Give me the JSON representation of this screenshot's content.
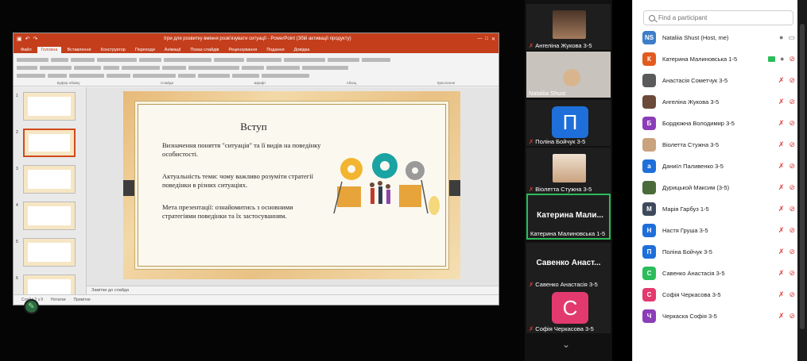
{
  "powerpoint": {
    "window_title": "Ігри для розвитку вміння розв'язувати ситуації - PowerPoint (Збій активації продукту)",
    "tabs": [
      "Файл",
      "Головна",
      "Вставлення",
      "Конструктор",
      "Переходи",
      "Анімації",
      "Показ слайдів",
      "Рецензування",
      "Подання",
      "Довідка"
    ],
    "active_tab": "Головна",
    "ribbon_groups": [
      "Буфер обміну",
      "Слайди",
      "Шрифт",
      "Абзац",
      "Креслення"
    ],
    "notes_placeholder": "Замітки до слайда",
    "status_items": [
      "Слайд 2 з 9",
      "Нотатки",
      "Примітки"
    ],
    "slide": {
      "title": "Вступ",
      "paragraphs": [
        "Визначення поняття \"ситуація\" та її видів на поведінку особистості.",
        "Актуальність теми: чому важливо розуміти стратегії поведінки в різних ситуаціях.",
        "Мета презентації: ознайомитись з основними стратегіями поведінки та їх застосуванням."
      ]
    },
    "thumb_numbers": [
      "1",
      "2",
      "3",
      "4",
      "5",
      "6"
    ]
  },
  "video_tiles": [
    {
      "name": "Ангеліна Жукова 3-5",
      "muted": true
    },
    {
      "name": "Nataliia Shust",
      "muted": false
    },
    {
      "name": "Поліна Бойчук 3-5",
      "muted": true,
      "initial": "П",
      "color": "#1e6fd9"
    },
    {
      "name": "Віолетта Стужна 3-5",
      "muted": true
    },
    {
      "name": "Катерина Малиновська 1-5",
      "big_name": "Катерина Мали...",
      "muted": false,
      "active": true
    },
    {
      "name": "Савенко Анастасія 3-5",
      "big_name": "Савенко Анаст...",
      "muted": true
    },
    {
      "name": "Софія Черкасова 3-5",
      "muted": true,
      "initial": "С",
      "color": "#e23a6f"
    }
  ],
  "participants_panel": {
    "search_placeholder": "Find a participant",
    "participants": [
      {
        "initials": "NS",
        "name": "Nataliia Shust (Host, me)",
        "color": "#3d7dc9",
        "mic": "on",
        "cam": "on"
      },
      {
        "initials": "К",
        "name": "Катерина Малиновська 1-5",
        "color": "#e25b1f",
        "mic": "on",
        "cam": "off",
        "sharing": true
      },
      {
        "initials": "",
        "name": "Анастасія Сометчук 3-5",
        "color": "#5a5a5a",
        "mic": "off",
        "cam": "off"
      },
      {
        "initials": "",
        "name": "Ангеліна Жукова 3-5",
        "color": "#6b4a3a",
        "mic": "off",
        "cam": "off"
      },
      {
        "initials": "Б",
        "name": "Бордюжна Володимир 3-5",
        "color": "#8b3db8",
        "mic": "off",
        "cam": "off"
      },
      {
        "initials": "",
        "name": "Віолетта Стужна 3-5",
        "color": "#c9a27e",
        "mic": "off",
        "cam": "off"
      },
      {
        "initials": "а",
        "name": "Даниїл Паливенко 3-5",
        "color": "#1e6fd9",
        "mic": "off",
        "cam": "off"
      },
      {
        "initials": "",
        "name": "Дурицькой Максим (3-5)",
        "color": "#4a6b3a",
        "mic": "off",
        "cam": "off"
      },
      {
        "initials": "М",
        "name": "Марія Гарбуз 1-5",
        "color": "#3e4a5c",
        "mic": "off",
        "cam": "off"
      },
      {
        "initials": "Н",
        "name": "Настя Груша 3-5",
        "color": "#1e6fd9",
        "mic": "off",
        "cam": "off"
      },
      {
        "initials": "П",
        "name": "Поліна Бойчук 3-5",
        "color": "#1e6fd9",
        "mic": "off",
        "cam": "off"
      },
      {
        "initials": "С",
        "name": "Савенко Анастасія 3-5",
        "color": "#2bbd5a",
        "mic": "off",
        "cam": "off"
      },
      {
        "initials": "С",
        "name": "Софія Черкасова 3-5",
        "color": "#e23a6f",
        "mic": "off",
        "cam": "off"
      },
      {
        "initials": "Ч",
        "name": "Черкаска Софія 3-5",
        "color": "#8b3db8",
        "mic": "off",
        "cam": "off"
      }
    ]
  }
}
